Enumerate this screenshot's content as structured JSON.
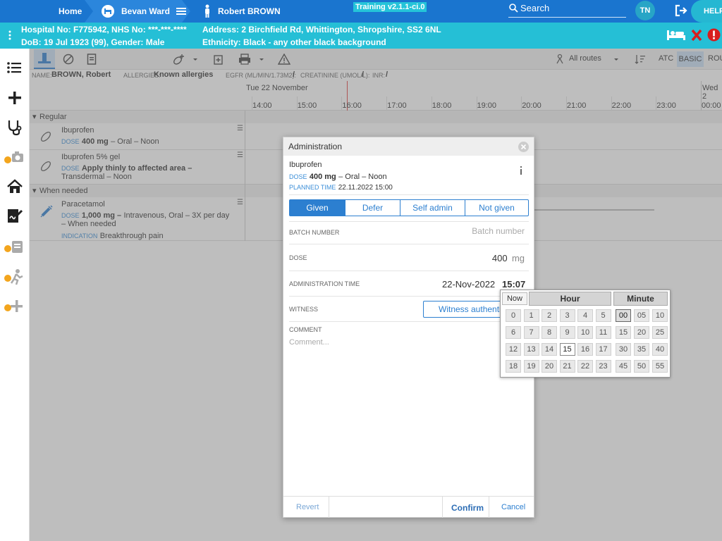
{
  "topbar": {
    "home_label": "Home",
    "ward_label": "Bevan Ward",
    "patient_label": "Robert BROWN",
    "training_label": "Training v2.1.1-ci.0",
    "search_placeholder": "Search",
    "user_initials": "TN",
    "help_label": "HELP"
  },
  "banner": {
    "line1_left": "Hospital No: F775942, NHS No: ***-***-****",
    "line2_left": "DoB: 19 Jul 1923 (99), Gender: Male",
    "line1_right": "Address: 2 Birchfield Rd, Whittington, Shropshire, SS2 6NL",
    "line2_right": "Ethnicity: Black - any other black background"
  },
  "toolbar": {
    "routes_label": "All routes",
    "atc_label": "ATC",
    "basic_label": "BASIC",
    "rou_label": "ROU"
  },
  "patient_header": {
    "name_label": "NAME:",
    "name_value": "BROWN, Robert",
    "allergies_label": "ALLERGIES:",
    "allergies_value": "Known allergies",
    "egfr_label": "EGFR (ML/MIN/1.73M2):",
    "egfr_value": "/",
    "creat_label": "CREATININE (UMOL/L):",
    "creat_value": "/",
    "inr_label": "INR:",
    "inr_value": "/"
  },
  "timeline": {
    "date_left": "Tue 22 November",
    "date_right": "Wed 2",
    "hours": [
      "14:00",
      "15:00",
      "16:00",
      "17:00",
      "18:00",
      "19:00",
      "20:00",
      "21:00",
      "22:00",
      "23:00",
      "00:00"
    ]
  },
  "sections": {
    "regular": "Regular",
    "when_needed": "When needed"
  },
  "drugs": [
    {
      "name": "Ibuprofen",
      "dose_label": "DOSE",
      "dose": "400 mg",
      "rest": "– Oral – Noon"
    },
    {
      "name": "Ibuprofen 5% gel",
      "dose_label": "DOSE",
      "dose": "Apply thinly to affected area –",
      "rest2": "Transdermal – Noon"
    },
    {
      "name": "Paracetamol",
      "dose_label": "DOSE",
      "dose": "1,000 mg –",
      "rest": "Intravenous, Oral – 3X per day",
      "rest2": "– When needed",
      "indication_label": "INDICATION",
      "indication": "Breakthrough pain"
    }
  ],
  "modal": {
    "title": "Administration",
    "drug_name": "Ibuprofen",
    "dose_label": "DOSE",
    "dose_value": "400 mg",
    "dose_rest": "– Oral – Noon",
    "planned_label": "PLANNED TIME",
    "planned_value": "22.11.2022 15:00",
    "tabs": [
      "Given",
      "Defer",
      "Self admin",
      "Not given"
    ],
    "batch_label": "BATCH NUMBER",
    "batch_placeholder": "Batch number",
    "dose_field_label": "DOSE",
    "dose_amount": "400",
    "dose_unit": "mg",
    "admin_time_label": "ADMINISTRATION TIME",
    "admin_date": "22-Nov-2022",
    "admin_time": "15:07",
    "witness_label": "WITNESS",
    "witness_button": "Witness authenticate",
    "comment_label": "COMMENT",
    "comment_placeholder": "Comment...",
    "revert_label": "Revert",
    "confirm_label": "Confirm",
    "cancel_label": "Cancel"
  },
  "picker": {
    "now_label": "Now",
    "hour_label": "Hour",
    "minute_label": "Minute",
    "hours": [
      "0",
      "1",
      "2",
      "3",
      "4",
      "5",
      "6",
      "7",
      "8",
      "9",
      "10",
      "11",
      "12",
      "13",
      "14",
      "15",
      "16",
      "17",
      "18",
      "19",
      "20",
      "21",
      "22",
      "23"
    ],
    "minutes": [
      "00",
      "05",
      "10",
      "15",
      "20",
      "25",
      "30",
      "35",
      "40",
      "45",
      "50",
      "55"
    ],
    "selected_hour": "15",
    "selected_minute": "00"
  }
}
